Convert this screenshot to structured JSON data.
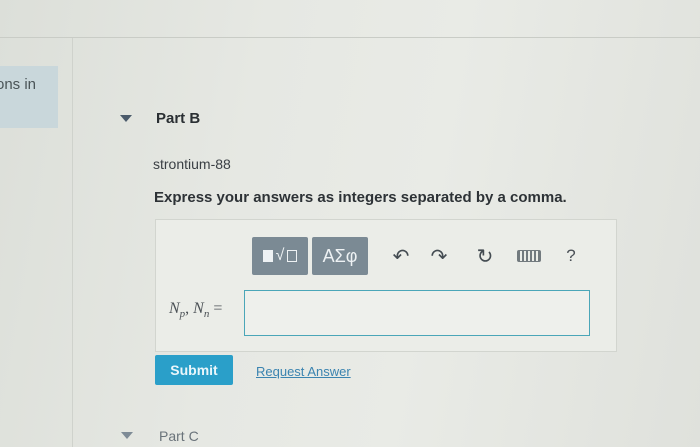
{
  "sidebar": {
    "fragment_text": "ons in"
  },
  "part_b": {
    "title": "Part B",
    "isotope": "strontium-88",
    "instructions": "Express your answers as integers separated by a comma."
  },
  "toolbar": {
    "templates_icon": "templates-icon",
    "symbols_label": "ΑΣφ",
    "undo_icon": "undo-icon",
    "redo_icon": "redo-icon",
    "reset_icon": "reset-icon",
    "keyboard_icon": "keyboard-icon",
    "help_label": "?"
  },
  "answer": {
    "var1": "N",
    "sub1": "p",
    "sep": ", ",
    "var2": "N",
    "sub2": "n",
    "equals": "=",
    "value": ""
  },
  "actions": {
    "submit_label": "Submit",
    "request_answer_label": "Request Answer"
  },
  "part_c": {
    "title": "Part C"
  },
  "colors": {
    "submit_bg": "#2a9fc9",
    "toolbar_btn_bg": "#7b8a94",
    "input_border": "#4aa6b8",
    "link": "#3b84b0"
  }
}
